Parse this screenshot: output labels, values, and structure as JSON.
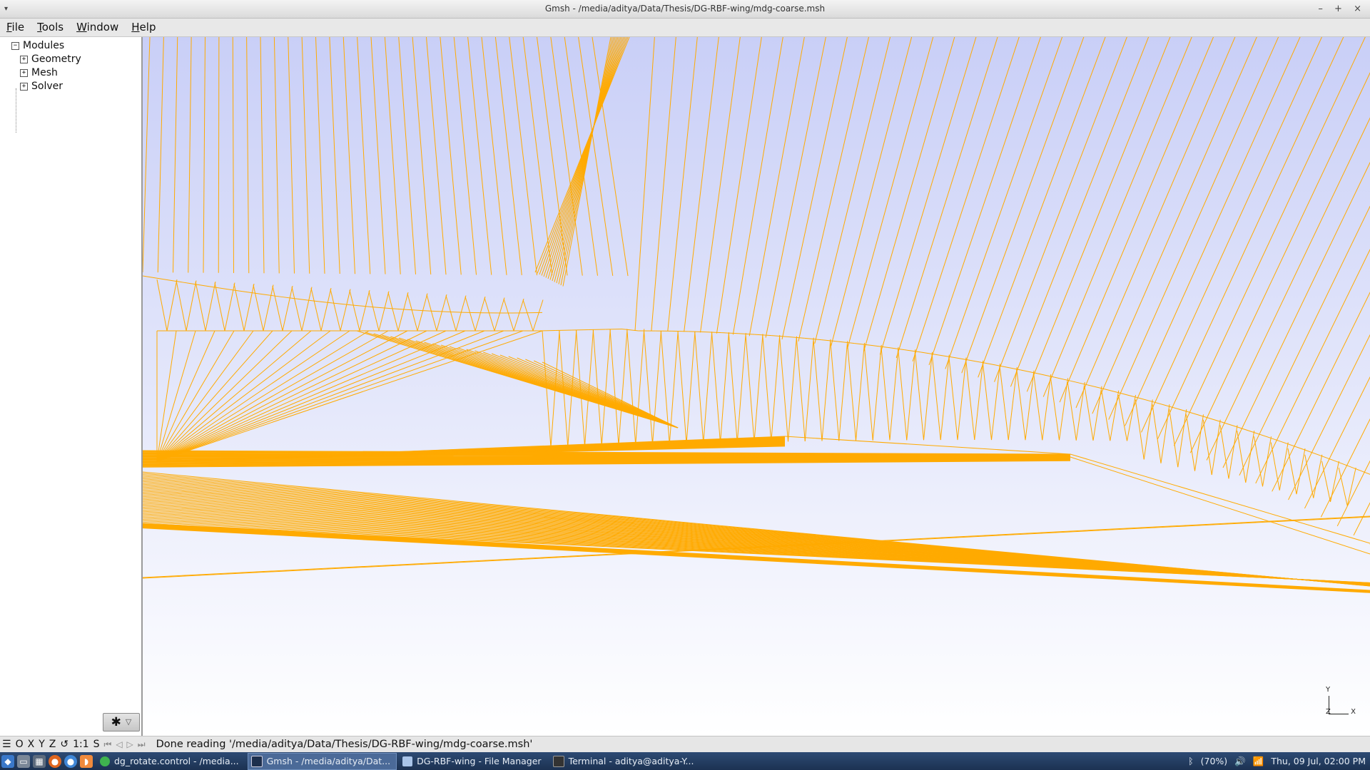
{
  "window": {
    "title": "Gmsh - /media/aditya/Data/Thesis/DG-RBF-wing/mdg-coarse.msh",
    "menu_glyph": "▾",
    "controls": [
      "–",
      "+",
      "×"
    ]
  },
  "menubar": {
    "items": [
      {
        "label": "File",
        "accel": "F",
        "rest": "ile"
      },
      {
        "label": "Tools",
        "accel": "T",
        "rest": "ools"
      },
      {
        "label": "Window",
        "accel": "W",
        "rest": "indow"
      },
      {
        "label": "Help",
        "accel": "H",
        "rest": "elp"
      }
    ]
  },
  "tree": {
    "root": {
      "label": "Modules",
      "expander": "−"
    },
    "items": [
      {
        "label": "Geometry",
        "expander": "+"
      },
      {
        "label": "Mesh",
        "expander": "+"
      },
      {
        "label": "Solver",
        "expander": "+"
      }
    ]
  },
  "options_button": {
    "gear": "✱",
    "arrow": "▽"
  },
  "viewport": {
    "mesh_color": "#ffaa00",
    "axes": {
      "y": "Y",
      "z": "Z",
      "x": "X"
    }
  },
  "statusbar": {
    "buttons": [
      "☰",
      "O",
      "X",
      "Y",
      "Z",
      "↺",
      "1:1",
      "S"
    ],
    "anim_buttons": [
      "⏮",
      "◁",
      "▷",
      "⏭"
    ],
    "message": "Done reading '/media/aditya/Data/Thesis/DG-RBF-wing/mdg-coarse.msh'"
  },
  "taskbar": {
    "tasks": [
      {
        "label": "dg_rotate.control - /media...",
        "color": "#3fb34f",
        "active": false
      },
      {
        "label": "Gmsh - /media/aditya/Dat...",
        "color": "#1d2f4d",
        "active": true
      },
      {
        "label": "DG-RBF-wing - File Manager",
        "color": "#a9c4e8",
        "active": false
      },
      {
        "label": "Terminal - aditya@aditya-Y...",
        "color": "#333333",
        "active": false
      }
    ],
    "tray": {
      "bluetooth": "ᛒ",
      "battery": "(70%)",
      "volume": "🔊",
      "wifi": "📶",
      "clock": "Thu, 09 Jul, 02:00 PM"
    }
  }
}
